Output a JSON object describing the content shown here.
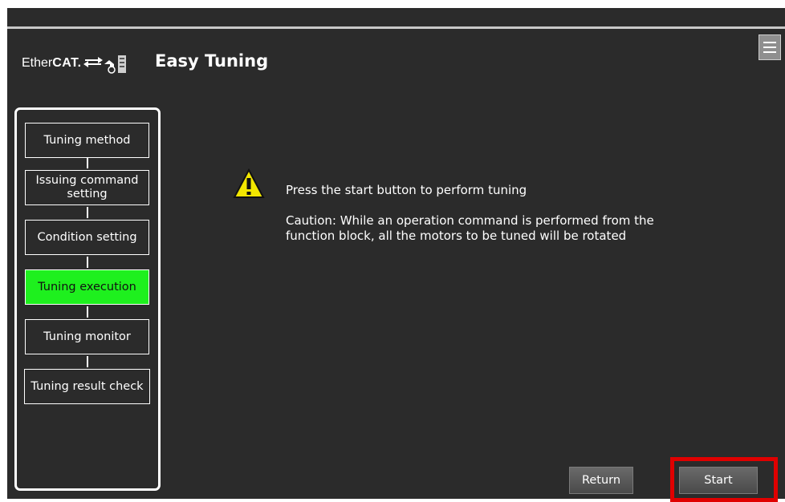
{
  "header": {
    "logo_text_ether": "Ether",
    "logo_text_cat": "CAT.",
    "title": "Easy Tuning",
    "menu_icon": "hamburger-menu-icon"
  },
  "steps": [
    {
      "label": "Tuning method",
      "active": false
    },
    {
      "label_line1": "Issuing command",
      "label_line2": "setting",
      "active": false
    },
    {
      "label": "Condition setting",
      "active": false
    },
    {
      "label": "Tuning execution",
      "active": true
    },
    {
      "label": "Tuning monitor",
      "active": false
    },
    {
      "label": "Tuning result check",
      "active": false
    }
  ],
  "message": {
    "icon": "warning-triangle-icon",
    "main": "Press the start button to perform tuning",
    "caution": "Caution: While an operation command is performed from the function block, all the motors to be tuned will be rotated"
  },
  "buttons": {
    "return_label": "Return",
    "start_label": "Start"
  },
  "colors": {
    "background": "#2b2b2b",
    "active_step": "#1ef01e",
    "highlight": "#e00000"
  }
}
